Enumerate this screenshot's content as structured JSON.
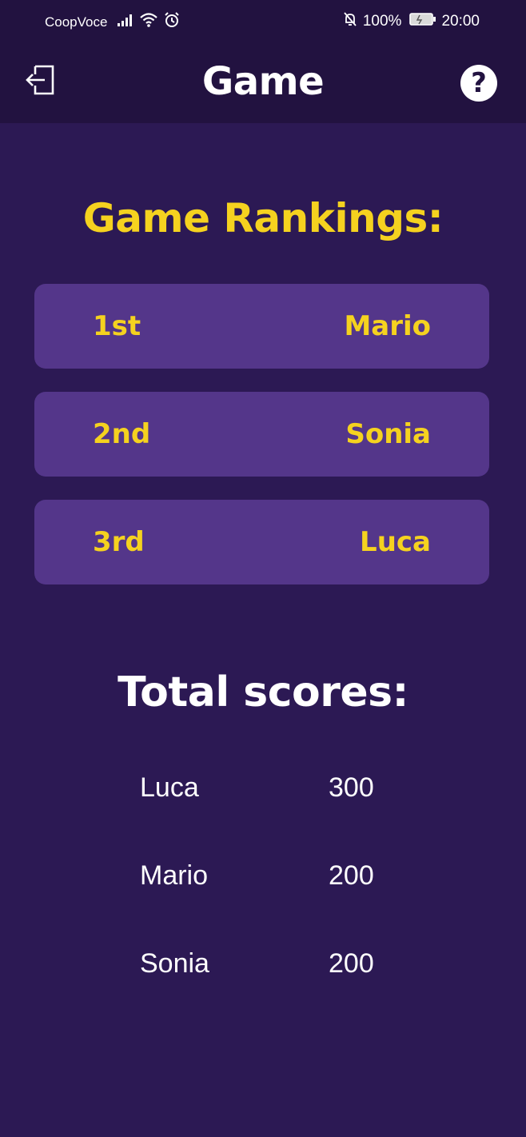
{
  "status_bar": {
    "carrier": "CoopVoce",
    "battery": "100%",
    "time": "20:00",
    "icons": [
      "signal-icon",
      "wifi-icon",
      "alarm-icon",
      "bell-off-icon",
      "battery-charging-icon"
    ]
  },
  "app_bar": {
    "title": "Game",
    "exit_icon": "exit-icon",
    "help_icon": "help-icon",
    "help_glyph": "?"
  },
  "rankings": {
    "title": "Game Rankings:",
    "items": [
      {
        "position": "1st",
        "name": "Mario"
      },
      {
        "position": "2nd",
        "name": "Sonia"
      },
      {
        "position": "3rd",
        "name": "Luca"
      }
    ]
  },
  "scores": {
    "title": "Total scores:",
    "rows": [
      {
        "name": "Luca",
        "score": "300"
      },
      {
        "name": "Mario",
        "score": "200"
      },
      {
        "name": "Sonia",
        "score": "200"
      }
    ]
  },
  "colors": {
    "background": "#2c1954",
    "header": "#221240",
    "card": "#54368a",
    "accent_yellow": "#f5d21f",
    "text_white": "#ffffff"
  }
}
